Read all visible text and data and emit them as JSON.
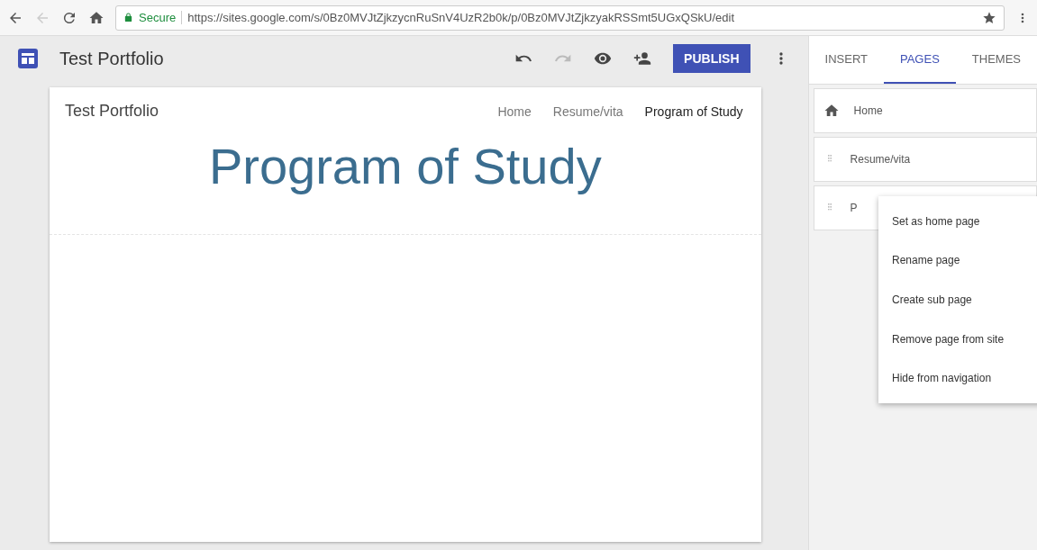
{
  "browser": {
    "secure_label": "Secure",
    "url": "https://sites.google.com/s/0Bz0MVJtZjkzycnRuSnV4UzR2b0k/p/0Bz0MVJtZjkzyakRSSmt5UGxQSkU/edit"
  },
  "app_bar": {
    "title": "Test Portfolio",
    "publish": "PUBLISH"
  },
  "site": {
    "name": "Test Portfolio",
    "nav": [
      {
        "label": "Home",
        "selected": false
      },
      {
        "label": "Resume/vita",
        "selected": false
      },
      {
        "label": "Program of Study",
        "selected": true
      }
    ],
    "heading": "Program of Study"
  },
  "panel": {
    "tabs": [
      {
        "label": "INSERT",
        "selected": false
      },
      {
        "label": "PAGES",
        "selected": true
      },
      {
        "label": "THEMES",
        "selected": false
      }
    ],
    "pages": [
      {
        "label": "Home",
        "kind": "home"
      },
      {
        "label": "Resume/vita",
        "kind": "page"
      },
      {
        "label": "P",
        "kind": "page"
      }
    ],
    "menu": [
      "Set as home page",
      "Rename page",
      "Create sub page",
      "Remove page from site",
      "Hide from navigation"
    ]
  }
}
